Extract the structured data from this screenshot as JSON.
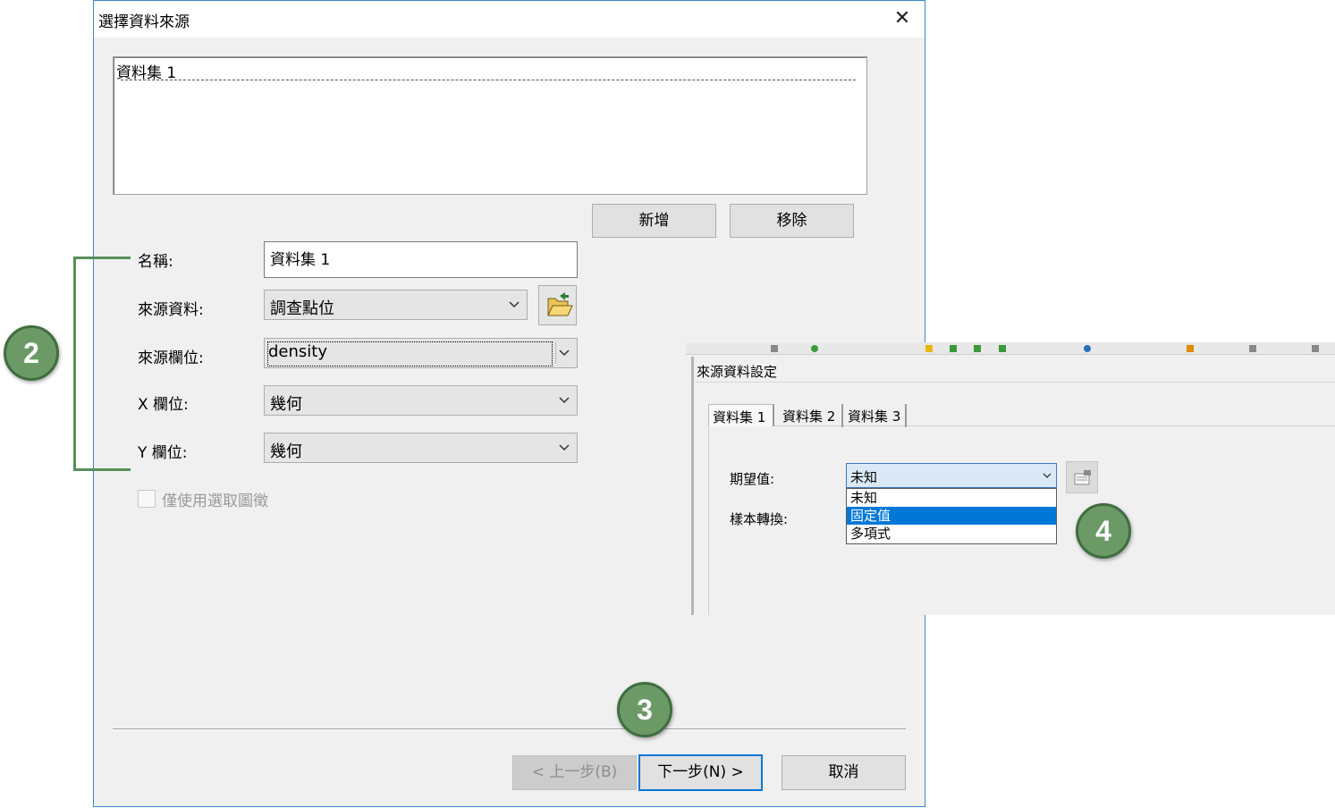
{
  "dialog": {
    "title": "選擇資料來源",
    "dataset_list": [
      "資料集 1"
    ],
    "buttons": {
      "add": "新增",
      "remove": "移除"
    },
    "fields": {
      "name_label": "名稱:",
      "name_value": "資料集 1",
      "source_label": "來源資料:",
      "source_value": "調查點位",
      "field_label": "來源欄位:",
      "field_value": "density",
      "x_label": "X 欄位:",
      "x_value": "幾何",
      "y_label": "Y 欄位:",
      "y_value": "幾何"
    },
    "checkbox_label": "僅使用選取圖徵",
    "footer": {
      "back": "< 上一步(B)",
      "next": "下一步(N) >",
      "cancel": "取消"
    }
  },
  "callouts": [
    "2",
    "3",
    "4"
  ],
  "overlay": {
    "title": "來源資料設定",
    "tabs": [
      "資料集 1",
      "資料集 2",
      "資料集 3"
    ],
    "expected_label": "期望值:",
    "expected_value": "未知",
    "transform_label": "樣本轉換:",
    "options": [
      "未知",
      "固定值",
      "多項式"
    ],
    "selected_option": "固定值"
  },
  "colors": {
    "callout_fill": "#6b9a67",
    "callout_border": "#3f6e3f",
    "selection": "#0078d7",
    "focus_border": "#0078d7"
  },
  "icons": [
    "close-icon",
    "folder-open-icon",
    "chevron-down-icon",
    "settings-icon"
  ]
}
